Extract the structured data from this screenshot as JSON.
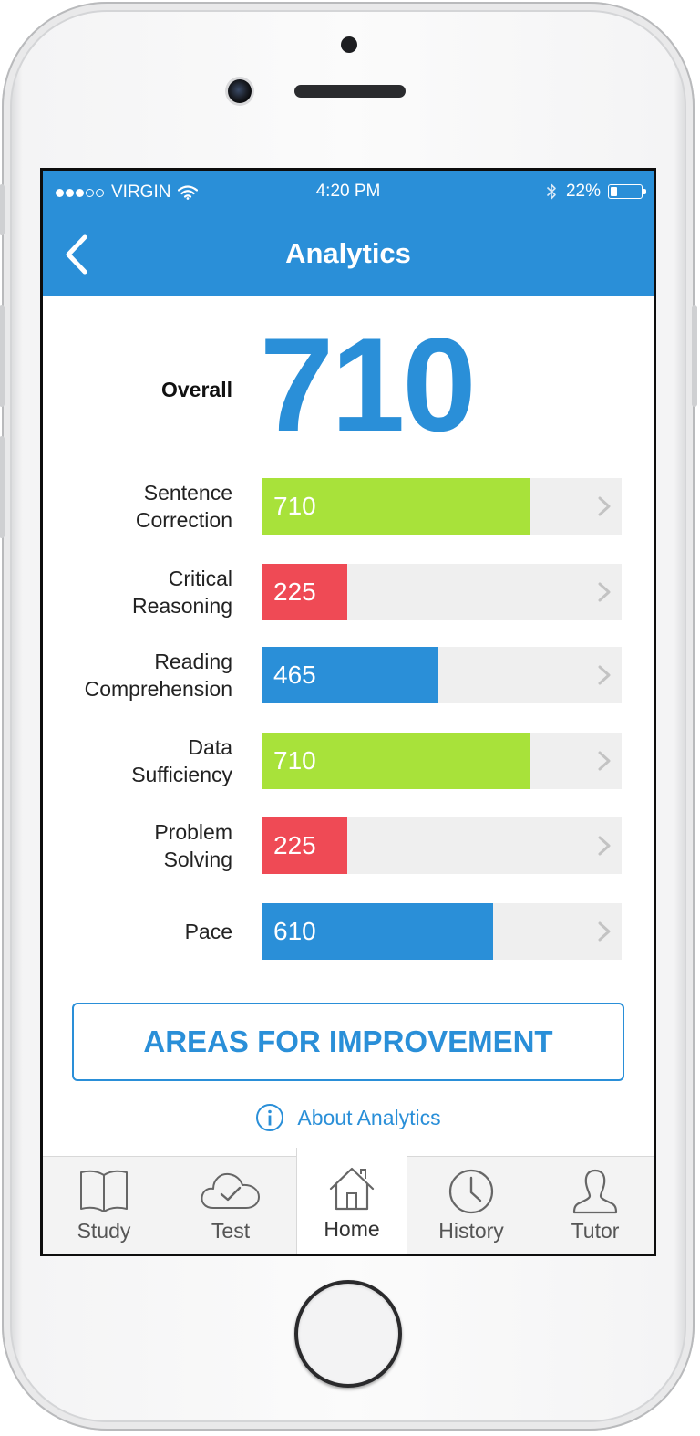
{
  "status_bar": {
    "carrier": "VIRGIN",
    "time": "4:20 PM",
    "battery_percent": "22%",
    "battery_level": 0.22,
    "signal_bars": 3,
    "icons": [
      "wifi-icon",
      "bluetooth-icon",
      "battery-icon"
    ]
  },
  "nav": {
    "title": "Analytics",
    "back_icon": "chevron-left-icon"
  },
  "overall": {
    "label": "Overall",
    "score": "710"
  },
  "metrics": [
    {
      "label": "Sentence\nCorrection",
      "value": 710,
      "display": "710",
      "color": "#a8e23a"
    },
    {
      "label": "Critical\nReasoning",
      "value": 225,
      "display": "225",
      "color": "#ef4a55"
    },
    {
      "label": "Reading\nComprehension",
      "value": 465,
      "display": "465",
      "color": "#2a8fd8"
    },
    {
      "label": "Data\nSufficiency",
      "value": 710,
      "display": "710",
      "color": "#a8e23a"
    },
    {
      "label": "Problem\nSolving",
      "value": 225,
      "display": "225",
      "color": "#ef4a55"
    },
    {
      "label": "Pace",
      "value": 610,
      "display": "610",
      "color": "#2a8fd8"
    }
  ],
  "scale_max": 950,
  "improvement_button": "AREAS FOR IMPROVEMENT",
  "about_link": "About Analytics",
  "tabs": [
    {
      "label": "Study",
      "icon": "book-icon"
    },
    {
      "label": "Test",
      "icon": "cloud-check-icon"
    },
    {
      "label": "Home",
      "icon": "house-icon",
      "active": true
    },
    {
      "label": "History",
      "icon": "clock-icon"
    },
    {
      "label": "Tutor",
      "icon": "person-icon"
    }
  ],
  "colors": {
    "accent": "#2a8fd8",
    "green": "#a8e23a",
    "red": "#ef4a55",
    "track": "#efefef"
  }
}
